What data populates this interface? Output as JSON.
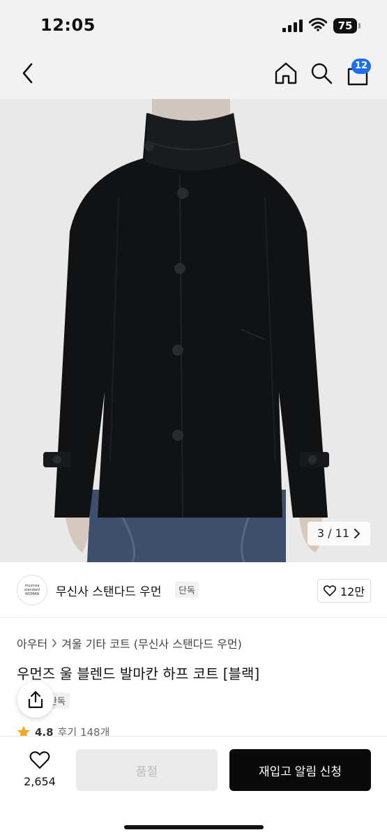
{
  "status_bar": {
    "time": "12:05",
    "battery": "75"
  },
  "nav": {
    "cart_count": "12"
  },
  "product_image": {
    "counter": "3 / 11"
  },
  "brand": {
    "logo_lines": [
      "musinsa",
      "standard",
      "WOMAN"
    ],
    "name": "무신사 스탠다드 우먼",
    "tag": "단독",
    "likes": "12만"
  },
  "breadcrumb": {
    "level1": "아우터",
    "level2": "겨울 기타 코트 (무신사 스탠다드 우먼)"
  },
  "product": {
    "title": "우먼즈 울 블렌드 발마칸 하프 코트 [블랙]",
    "exclusive_tag": "단독",
    "rating": "4.8",
    "reviews": "후기 148개"
  },
  "bottom_bar": {
    "like_count": "2,654",
    "soldout_label": "품절",
    "restock_label": "재입고 알림 신청"
  },
  "colors": {
    "badge": "#1f6feb",
    "star": "#f5a623",
    "cta": "#0a0a0a"
  }
}
